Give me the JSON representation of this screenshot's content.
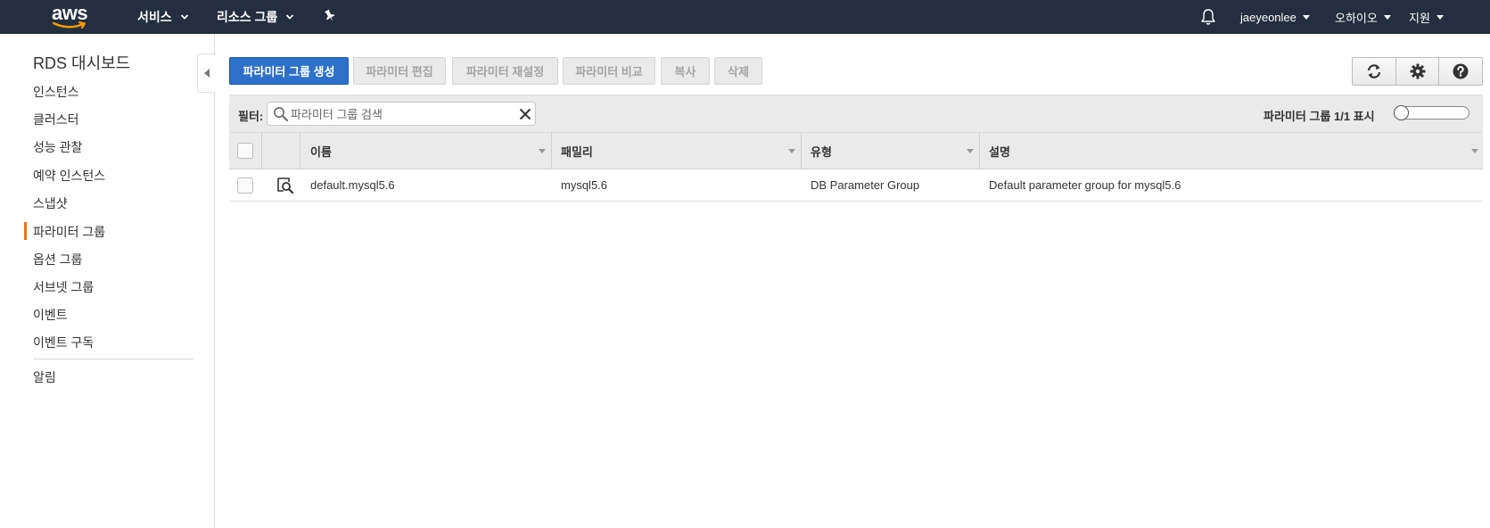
{
  "topbar": {
    "logo_text": "aws",
    "services_label": "서비스",
    "resource_groups_label": "리소스 그룹",
    "user_label": "jaeyeonlee",
    "region_label": "오하이오",
    "support_label": "지원",
    "icons": [
      "chevron-down-icon",
      "pin-icon",
      "bell-icon"
    ]
  },
  "sidebar": {
    "title": "RDS 대시보드",
    "items": [
      {
        "label": "인스턴스"
      },
      {
        "label": "클러스터"
      },
      {
        "label": "성능 관찰"
      },
      {
        "label": "예약 인스턴스"
      },
      {
        "label": "스냅샷"
      },
      {
        "label": "파라미터 그룹",
        "active": true
      },
      {
        "label": "옵션 그룹"
      },
      {
        "label": "서브넷 그룹"
      },
      {
        "label": "이벤트"
      },
      {
        "label": "이벤트 구독"
      }
    ],
    "footer_items": [
      {
        "label": "알림"
      }
    ],
    "active_color": "#ec7211"
  },
  "toolbar": {
    "create_label": "파라미터 그룹 생성",
    "edit_label": "파라미터 편집",
    "reset_label": "파라미터 재설정",
    "compare_label": "파라미터 비교",
    "copy_label": "복사",
    "delete_label": "삭제",
    "icon_buttons": [
      "refresh-icon",
      "gear-icon",
      "help-icon"
    ]
  },
  "filter": {
    "label": "필터:",
    "placeholder": "파라미터 그룹 검색",
    "value": "",
    "count_text": "파라미터 그룹 1/1 표시"
  },
  "table": {
    "columns": [
      "이름",
      "패밀리",
      "유형",
      "설명"
    ],
    "rows": [
      {
        "name": "default.mysql5.6",
        "family": "mysql5.6",
        "type": "DB Parameter Group",
        "description": "Default parameter group for mysql5.6",
        "icon": "details-magnifier-icon"
      }
    ]
  },
  "colors": {
    "topbar_bg": "#232f3e",
    "primary_button": "#2d70c9",
    "accent_orange": "#ec7211"
  }
}
